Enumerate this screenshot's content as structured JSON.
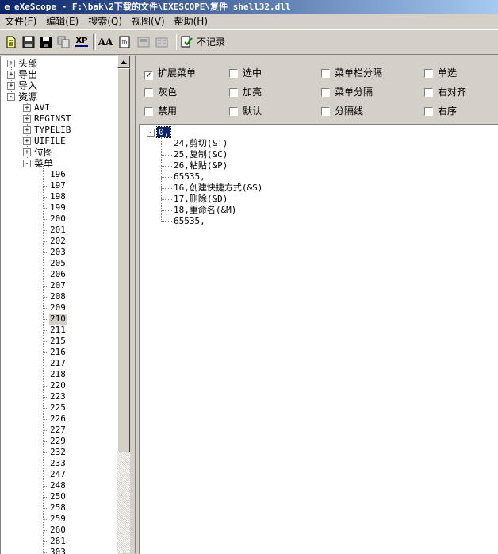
{
  "window": {
    "title": "eXeScope - F:\\bak\\2下载的文件\\EXESCOPE\\复件 shell32.dll"
  },
  "menubar": [
    {
      "label": "文件(F)"
    },
    {
      "label": "编辑(E)"
    },
    {
      "label": "搜索(Q)"
    },
    {
      "label": "视图(V)"
    },
    {
      "label": "帮助(H)"
    }
  ],
  "toolbar": {
    "no_record_label": "不记录",
    "buttons": [
      {
        "icon": "new-doc-icon"
      },
      {
        "icon": "save-icon"
      },
      {
        "icon": "save-all-icon"
      },
      {
        "icon": "copy-icon"
      },
      {
        "icon": "xp-icon",
        "text": "XP"
      },
      {
        "icon": "font-aa-icon",
        "text": "AA"
      },
      {
        "icon": "dialog-id-icon"
      },
      {
        "icon": "disabled-icon-1"
      },
      {
        "icon": "disabled-icon-2"
      },
      {
        "icon": "no-record-icon"
      }
    ]
  },
  "tree": {
    "top_level": [
      {
        "label": "头部",
        "expander": "+"
      },
      {
        "label": "导出",
        "expander": "+"
      },
      {
        "label": "导入",
        "expander": "+"
      },
      {
        "label": "资源",
        "expander": "-"
      }
    ],
    "resource_children": [
      {
        "label": "AVI",
        "expander": "+"
      },
      {
        "label": "REGINST",
        "expander": "+"
      },
      {
        "label": "TYPELIB",
        "expander": "+"
      },
      {
        "label": "UIFILE",
        "expander": "+"
      },
      {
        "label": "位图",
        "expander": "+"
      },
      {
        "label": "菜单",
        "expander": "-"
      }
    ],
    "menu_ids": [
      "196",
      "197",
      "198",
      "199",
      "200",
      "201",
      "202",
      "203",
      "205",
      "206",
      "207",
      "208",
      "209",
      "210",
      "211",
      "215",
      "216",
      "217",
      "218",
      "220",
      "223",
      "225",
      "226",
      "227",
      "229",
      "232",
      "233",
      "247",
      "248",
      "250",
      "258",
      "259",
      "260",
      "261",
      "303"
    ],
    "selected_id": "210"
  },
  "options": {
    "row1": [
      {
        "label": "扩展菜单",
        "checked": true
      },
      {
        "label": "选中",
        "checked": false
      },
      {
        "label": "菜单栏分隔",
        "checked": false
      },
      {
        "label": "单选",
        "checked": false
      }
    ],
    "row2": [
      {
        "label": "灰色",
        "checked": false
      },
      {
        "label": "加亮",
        "checked": false
      },
      {
        "label": "菜单分隔",
        "checked": false
      },
      {
        "label": "右对齐",
        "checked": false
      }
    ],
    "row3": [
      {
        "label": "禁用",
        "checked": false
      },
      {
        "label": "默认",
        "checked": false
      },
      {
        "label": "分隔线",
        "checked": false
      },
      {
        "label": "右序",
        "checked": false
      }
    ]
  },
  "menu_tree": {
    "root": "0,",
    "root_expander": "-",
    "items": [
      "24,剪切(&T)",
      "25,复制(&C)",
      "26,粘贴(&P)",
      "65535,",
      "16,创建快捷方式(&S)",
      "17,删除(&D)",
      "18,重命名(&M)",
      "65535,"
    ]
  }
}
